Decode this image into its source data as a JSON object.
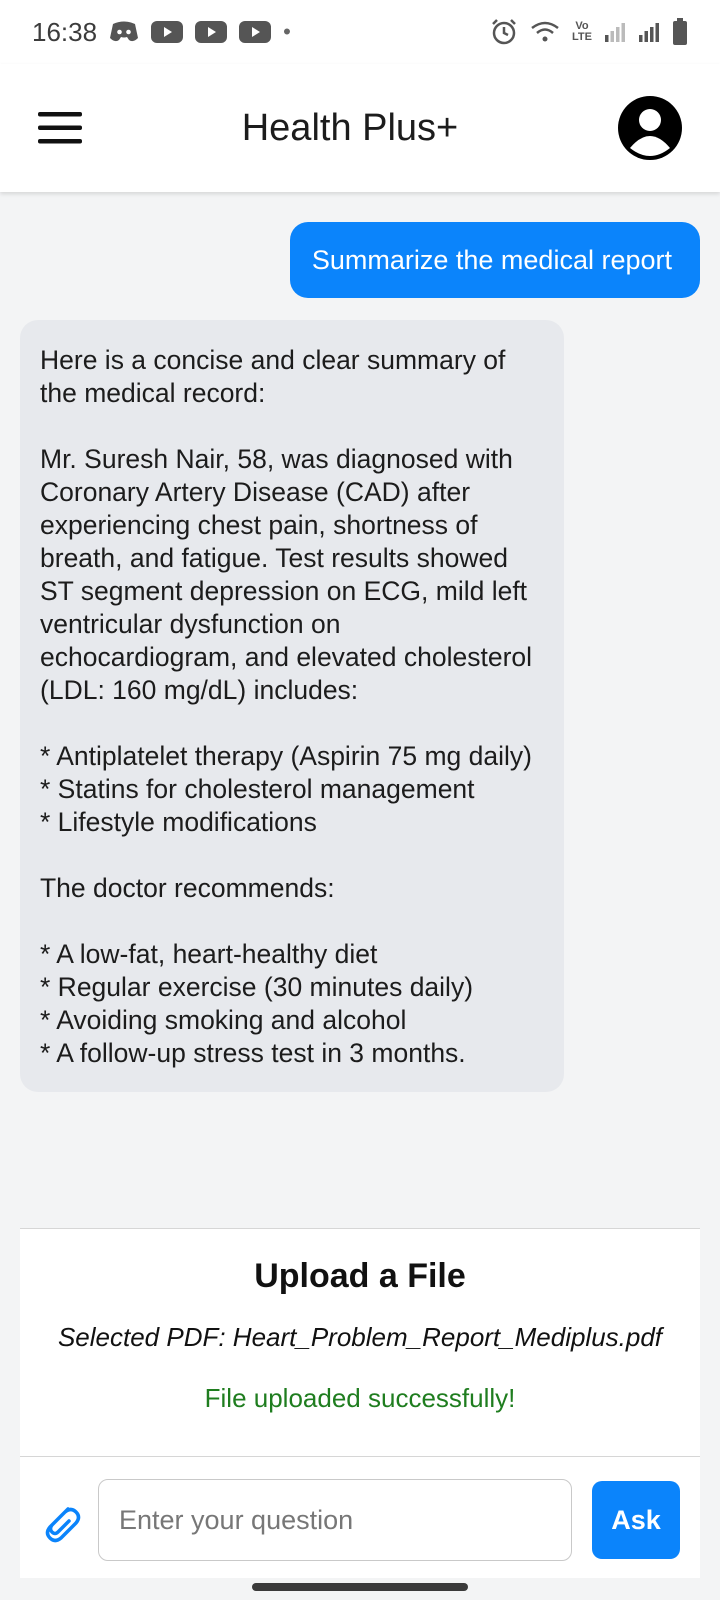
{
  "status_bar": {
    "time": "16:38",
    "notification_icons": [
      "discord-icon",
      "youtube-icon",
      "youtube-icon",
      "youtube-icon"
    ],
    "dot": "•",
    "right_icons": [
      "alarm-icon",
      "wifi-icon",
      "volte-icon",
      "signal-icon",
      "signal-icon",
      "battery-icon"
    ],
    "volte_text_top": "Vo",
    "volte_text_bottom": "LTE"
  },
  "app_bar": {
    "title": "Health Plus+",
    "menu_icon": "hamburger-menu-icon",
    "profile_icon": "account-circle-icon"
  },
  "chat": {
    "user_message": "Summarize the medical report",
    "bot_message": "Here is a concise and clear summary of the medical record:\n\nMr. Suresh Nair, 58, was diagnosed with Coronary Artery Disease (CAD) after experiencing chest pain, shortness of breath, and fatigue. Test results showed ST segment depression on ECG, mild left ventricular dysfunction on echocardiogram, and elevated cholesterol (LDL: 160 mg/dL) includes:\n\n* Antiplatelet therapy (Aspirin 75 mg daily)\n* Statins for cholesterol management\n* Lifestyle modifications\n\nThe doctor recommends:\n\n* A low-fat, heart-healthy diet\n* Regular exercise (30 minutes daily)\n* Avoiding smoking and alcohol\n* A follow-up stress test in 3 months."
  },
  "upload": {
    "title": "Upload a File",
    "selected_pdf": "Selected PDF: Heart_Problem_Report_Mediplus.pdf",
    "status": "File uploaded successfully!"
  },
  "input_bar": {
    "attach_icon": "paperclip-icon",
    "placeholder": "Enter your question",
    "value": "",
    "ask_label": "Ask"
  },
  "colors": {
    "accent": "#0b84fb",
    "bot_bubble": "#e7e9ed",
    "background": "#f3f4f5",
    "success": "#1f7d1f"
  }
}
